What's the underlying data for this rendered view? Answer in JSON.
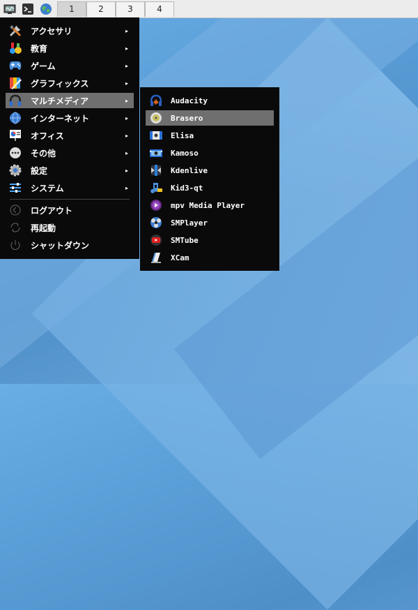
{
  "panel": {
    "launchers": [
      {
        "icon": "system-monitor-icon"
      },
      {
        "icon": "terminal-icon"
      },
      {
        "icon": "web-browser-icon"
      }
    ],
    "workspaces": [
      "1",
      "2",
      "3",
      "4"
    ],
    "active_workspace": "1"
  },
  "main_menu": {
    "items": [
      {
        "label": "アクセサリ",
        "icon": "accessories-icon",
        "submenu": true
      },
      {
        "label": "教育",
        "icon": "education-icon",
        "submenu": true
      },
      {
        "label": "ゲーム",
        "icon": "games-icon",
        "submenu": true
      },
      {
        "label": "グラフィックス",
        "icon": "graphics-icon",
        "submenu": true
      },
      {
        "label": "マルチメディア",
        "icon": "multimedia-icon",
        "submenu": true,
        "highlighted": true
      },
      {
        "label": "インターネット",
        "icon": "internet-icon",
        "submenu": true
      },
      {
        "label": "オフィス",
        "icon": "office-icon",
        "submenu": true
      },
      {
        "label": "その他",
        "icon": "other-icon",
        "submenu": true
      },
      {
        "label": "設定",
        "icon": "settings-icon",
        "submenu": true
      },
      {
        "label": "システム",
        "icon": "system-icon",
        "submenu": true
      }
    ],
    "session": [
      {
        "label": "ログアウト",
        "icon": "logout-icon"
      },
      {
        "label": "再起動",
        "icon": "reboot-icon"
      },
      {
        "label": "シャットダウン",
        "icon": "shutdown-icon"
      }
    ],
    "arrow": "▸"
  },
  "sub_menu": {
    "items": [
      {
        "label": "Audacity",
        "icon": "audacity-icon"
      },
      {
        "label": "Brasero",
        "icon": "brasero-icon",
        "highlighted": true
      },
      {
        "label": "Elisa",
        "icon": "elisa-icon"
      },
      {
        "label": "Kamoso",
        "icon": "kamoso-icon"
      },
      {
        "label": "Kdenlive",
        "icon": "kdenlive-icon"
      },
      {
        "label": "Kid3-qt",
        "icon": "kid3-icon"
      },
      {
        "label": "mpv Media Player",
        "icon": "mpv-icon"
      },
      {
        "label": "SMPlayer",
        "icon": "smplayer-icon"
      },
      {
        "label": "SMTube",
        "icon": "smtube-icon"
      },
      {
        "label": "XCam",
        "icon": "xcam-icon"
      }
    ]
  },
  "colors": {
    "menu_bg": "#0a0a0a",
    "highlight": "#6f6f6f",
    "panel_bg": "#ececec"
  }
}
